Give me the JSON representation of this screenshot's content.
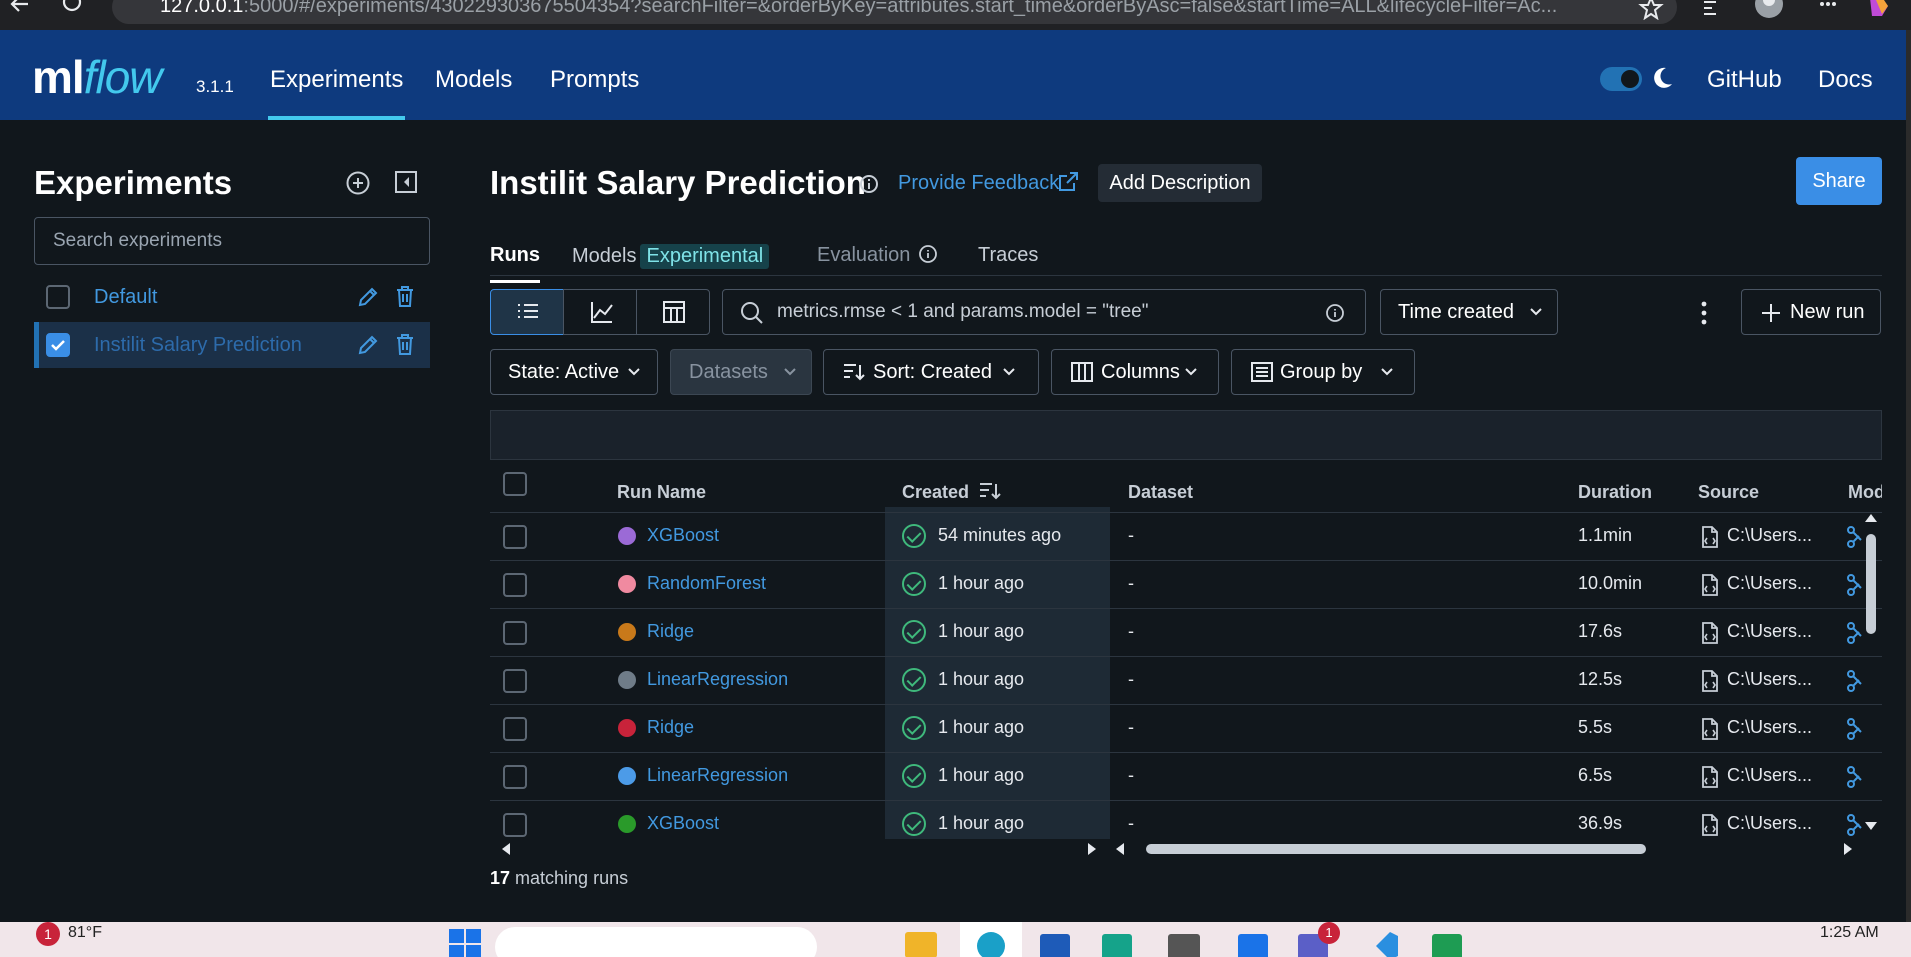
{
  "browser": {
    "url_host": "127.0.0.1",
    "url_rest": ":5000/#/experiments/430229303675504354?searchFilter=&orderByKey=attributes.start_time&orderByAsc=false&startTime=ALL&lifecycleFilter=Ac..."
  },
  "header": {
    "logo_main": "ml",
    "logo_flow": "flow",
    "version": "3.1.1",
    "nav": [
      "Experiments",
      "Models",
      "Prompts"
    ],
    "active_nav": "Experiments",
    "github": "GitHub",
    "docs": "Docs"
  },
  "sidebar": {
    "title": "Experiments",
    "search_placeholder": "Search experiments",
    "items": [
      {
        "label": "Default",
        "checked": false
      },
      {
        "label": "Instilit Salary Prediction",
        "checked": true
      }
    ]
  },
  "experiment": {
    "title": "Instilit Salary Prediction",
    "feedback": "Provide Feedback",
    "add_description": "Add Description",
    "share": "Share"
  },
  "tabs": {
    "runs": "Runs",
    "models": "Models",
    "models_badge": "Experimental",
    "evaluation": "Evaluation",
    "traces": "Traces"
  },
  "toolbar": {
    "search_value": "metrics.rmse < 1 and params.model = \"tree\"",
    "time_created": "Time created",
    "new_run": "New run",
    "state": "State: Active",
    "datasets": "Datasets",
    "sort": "Sort: Created",
    "columns": "Columns",
    "group_by": "Group by"
  },
  "table": {
    "headers": {
      "run_name": "Run Name",
      "created": "Created",
      "dataset": "Dataset",
      "duration": "Duration",
      "source": "Source",
      "models": "Mod"
    },
    "rows": [
      {
        "name": "XGBoost",
        "color": "#9b6ad6",
        "created": "54 minutes ago",
        "dataset": "-",
        "duration": "1.1min",
        "source": "C:\\Users..."
      },
      {
        "name": "RandomForest",
        "color": "#f08aa0",
        "created": "1 hour ago",
        "dataset": "-",
        "duration": "10.0min",
        "source": "C:\\Users..."
      },
      {
        "name": "Ridge",
        "color": "#c8791a",
        "created": "1 hour ago",
        "dataset": "-",
        "duration": "17.6s",
        "source": "C:\\Users..."
      },
      {
        "name": "LinearRegression",
        "color": "#6f7c88",
        "created": "1 hour ago",
        "dataset": "-",
        "duration": "12.5s",
        "source": "C:\\Users..."
      },
      {
        "name": "Ridge",
        "color": "#c8233a",
        "created": "1 hour ago",
        "dataset": "-",
        "duration": "5.5s",
        "source": "C:\\Users..."
      },
      {
        "name": "LinearRegression",
        "color": "#4c9be8",
        "created": "1 hour ago",
        "dataset": "-",
        "duration": "6.5s",
        "source": "C:\\Users..."
      },
      {
        "name": "XGBoost",
        "color": "#2a9a2a",
        "created": "1 hour ago",
        "dataset": "-",
        "duration": "36.9s",
        "source": "C:\\Users..."
      }
    ],
    "matching_count": "17",
    "matching_suffix": " matching runs"
  },
  "taskbar": {
    "weather": "81°F",
    "notif_count": "1",
    "time": "1:25 AM"
  }
}
